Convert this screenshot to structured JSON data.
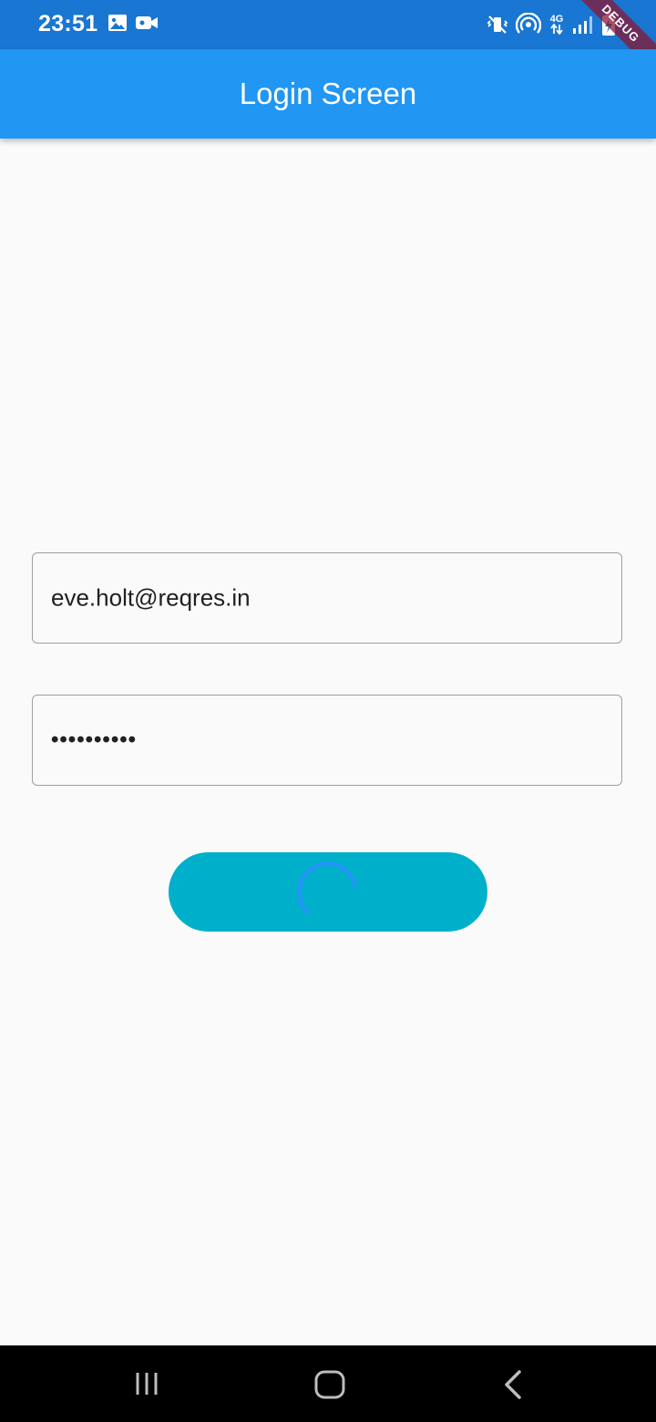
{
  "status_bar": {
    "time": "23:51",
    "network": "4G",
    "icons": [
      "gallery-icon",
      "video-camera-icon",
      "mute-vibrate-icon",
      "hotspot-icon",
      "signal-icon",
      "battery-charging-icon"
    ]
  },
  "debug_banner": "DEBUG",
  "app_bar": {
    "title": "Login Screen",
    "color": "#2196f3"
  },
  "form": {
    "email_value": "eve.holt@reqres.in",
    "password_value": "••••••••••",
    "login_button": {
      "state": "loading",
      "color": "#00b0cb",
      "spinner_icon": "progress-spinner-icon"
    }
  },
  "nav_bar": {
    "buttons": [
      "recent-apps-icon",
      "home-icon",
      "back-icon"
    ]
  }
}
